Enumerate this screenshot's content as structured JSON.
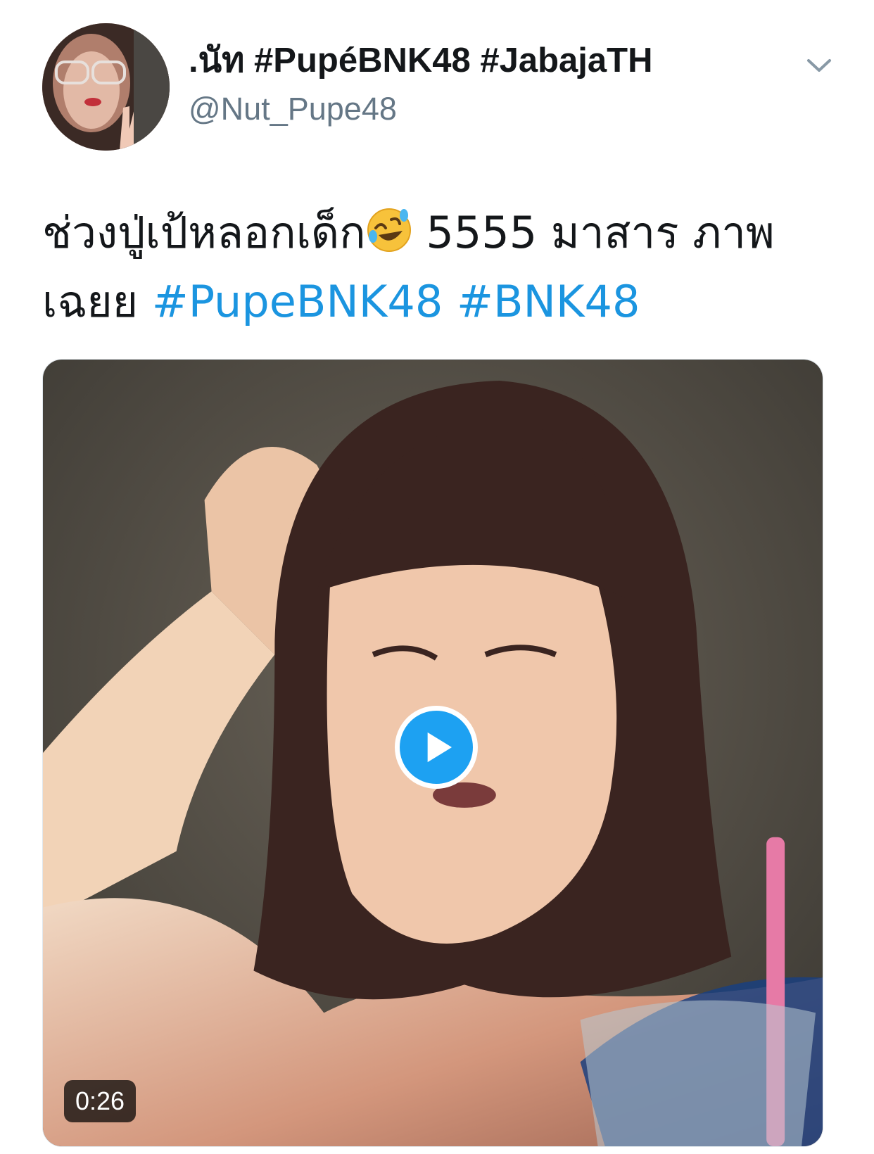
{
  "author": {
    "display_name": ".นัท #PupéBNK48 #JabajaTH",
    "handle": "@Nut_Pupe48"
  },
  "tweet": {
    "text_part1": "ช่วงปู่เป้หลอกเด็ก",
    "emoji": "rolling-on-floor-laughing",
    "text_part2": " 5555 มาสาร ภาพเฉยย ",
    "hashtags": [
      "#PupeBNK48",
      "#BNK48"
    ]
  },
  "media": {
    "type": "video",
    "duration": "0:26"
  },
  "colors": {
    "accent": "#1da1f2",
    "hashtag": "#1b95e0",
    "name": "#14171a",
    "handle": "#657786"
  }
}
